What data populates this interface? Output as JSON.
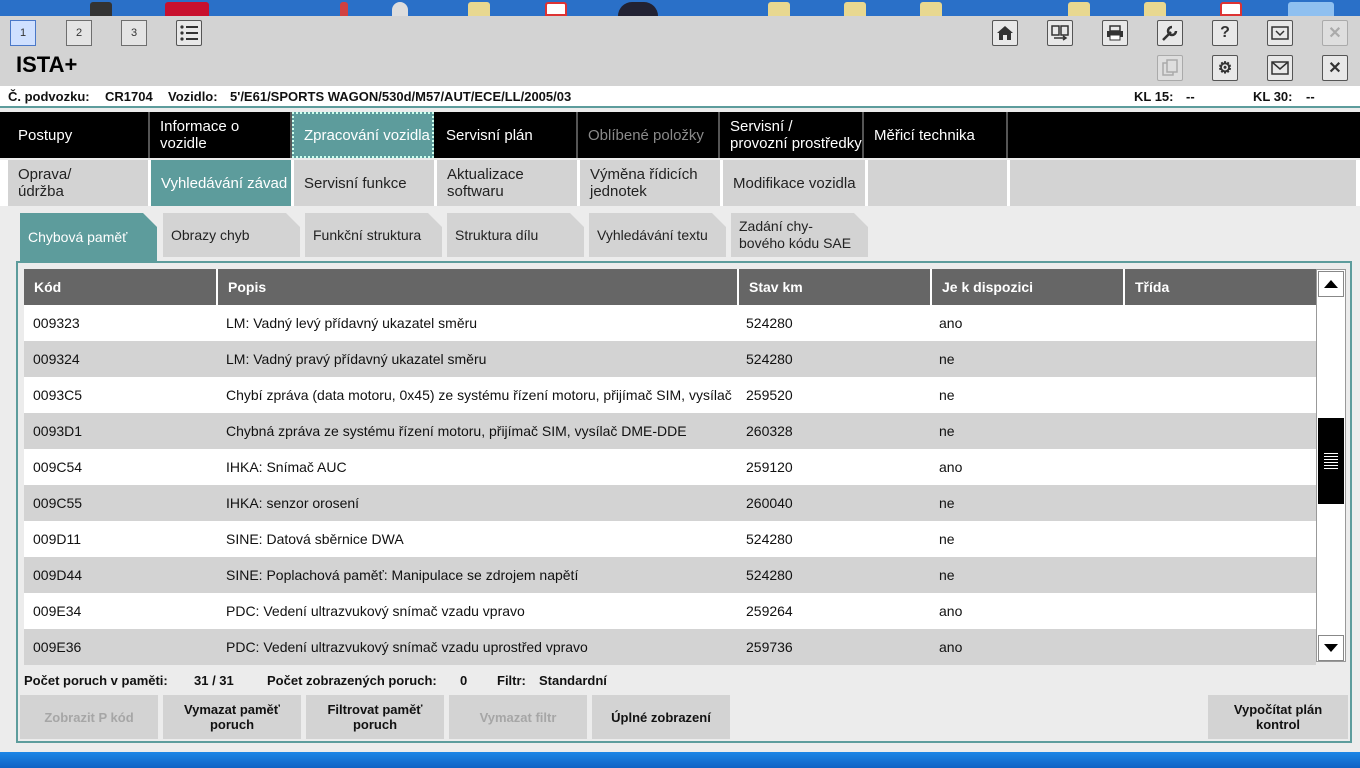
{
  "toolbar": {
    "tabs": [
      "1",
      "2",
      "3"
    ]
  },
  "app": {
    "title": "ISTA+"
  },
  "vehicle": {
    "chassis_label": "Č. podvozku:",
    "chassis_value": "CR1704",
    "vehicle_label": "Vozidlo:",
    "vehicle_value": "5'/E61/SPORTS WAGON/530d/M57/AUT/ECE/LL/2005/03",
    "kl15_label": "KL 15:",
    "kl15_value": "--",
    "kl30_label": "KL 30:",
    "kl30_value": "--"
  },
  "main_nav": [
    "Postupy",
    "Informace o vozidle",
    "Zpracování vozidla",
    "Servisní plán",
    "Oblíbené položky",
    "Servisní /\nprovozní prostředky",
    "Měřicí technika"
  ],
  "sub_nav": [
    "Oprava/\núdržba",
    "Vyhledávání závad",
    "Servisní funkce",
    "Aktualizace\nsoftwaru",
    "Výměna řídicích\njednotek",
    "Modifikace vozidla"
  ],
  "tabs": [
    "Chybová paměť",
    "Obrazy chyb",
    "Funkční struktura",
    "Struktura dílu",
    "Vyhledávání textu",
    "Zadání chy-\nbového kódu SAE"
  ],
  "table": {
    "headers": [
      "Kód",
      "Popis",
      "Stav km",
      "Je k dispozici",
      "Třída"
    ],
    "rows": [
      [
        "009323",
        "LM: Vadný levý přídavný ukazatel směru",
        "524280",
        "ano",
        ""
      ],
      [
        "009324",
        "LM: Vadný pravý přídavný ukazatel směru",
        "524280",
        "ne",
        ""
      ],
      [
        "0093C5",
        "Chybí zpráva (data motoru, 0x45) ze systému řízení motoru, přijímač SIM, vysílač",
        "259520",
        "ne",
        ""
      ],
      [
        "0093D1",
        "Chybná zpráva ze systému řízení motoru, přijímač SIM, vysílač DME-DDE",
        "260328",
        "ne",
        ""
      ],
      [
        "009C54",
        "IHKA: Snímač AUC",
        "259120",
        "ano",
        ""
      ],
      [
        "009C55",
        "IHKA: senzor orosení",
        "260040",
        "ne",
        ""
      ],
      [
        "009D11",
        "SINE: Datová sběrnice DWA",
        "524280",
        "ne",
        ""
      ],
      [
        "009D44",
        "SINE: Poplachová paměť: Manipulace se zdrojem napětí",
        "524280",
        "ne",
        ""
      ],
      [
        "009E34",
        "PDC: Vedení ultrazvukový snímač vzadu vpravo",
        "259264",
        "ano",
        ""
      ],
      [
        "009E36",
        "PDC: Vedení ultrazvukový snímač vzadu uprostřed vpravo",
        "259736",
        "ano",
        ""
      ]
    ]
  },
  "stats": {
    "faults_label": "Počet poruch v paměti:",
    "faults_value": "31 / 31",
    "shown_label": "Počet zobrazených poruch:",
    "shown_value": "0",
    "filter_label": "Filtr:",
    "filter_value": "Standardní"
  },
  "actions": {
    "show_p_code": "Zobrazit P kód",
    "clear_memory": "Vymazat paměť\nporuch",
    "filter_memory": "Filtrovat paměť\nporuch",
    "clear_filter": "Vymazat filtr",
    "full_view": "Úplné zobrazení",
    "calc_plan": "Vypočítat plán\nkontrol"
  },
  "colors": {
    "accent": "#5d9c9c",
    "nav_bg": "#000000",
    "header_bg": "#666666"
  },
  "icons": [
    "home-icon",
    "compare-icon",
    "print-icon",
    "wrench-icon",
    "help-icon",
    "minimize-icon",
    "close-icon",
    "copy-icon",
    "gear-icon",
    "mail-icon"
  ]
}
